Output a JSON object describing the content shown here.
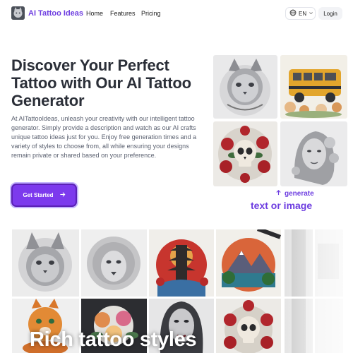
{
  "nav": {
    "brand": "AI Tattoo Ideas",
    "logo_icon": "cat-tattoo-logo-icon",
    "links": [
      "Home",
      "Features",
      "Pricing"
    ],
    "language": "EN",
    "globe_icon": "globe-icon",
    "chevron_icon": "chevron-down-icon",
    "login": "Login"
  },
  "hero": {
    "headline": "Discover Your Perfect Tattoo with Our AI Tattoo Generator",
    "description": "At AITattooIdeas, unleash your creativity with our intelligent tattoo generator. Simply provide a description and watch as our AI crafts unique tattoo ideas just for you. Enjoy free generation times and a variety of styles to choose from, all while ensuring your designs remain private or shared based on your preference.",
    "cta_label": "Get Started",
    "cta_icon": "arrow-right-icon",
    "images": [
      "cat-tattoo-image",
      "school-bus-tattoo-image",
      "skull-roses-tattoo-image",
      "woman-portrait-tattoo-image"
    ],
    "generate_note": "generate",
    "generate_note_icon": "arrow-up-icon",
    "generate_big": "text or image"
  },
  "gallery": {
    "images": [
      "lynx-tattoo-image",
      "lion-tattoo-image",
      "pagoda-tattoo-image",
      "landscape-circle-tattoo-image",
      "blurred-tattoo-image",
      "orange-cat-tattoo-image",
      "flower-bouquet-tattoo-image",
      "woman-portrait-tattoo-image",
      "skull-roses-tattoo-image",
      "blurred-tattoo-image"
    ],
    "title": "Rich tattoo styles"
  },
  "colors": {
    "accent": "#6d3de0",
    "button": "#7c3aed",
    "text": "#2b2f38"
  }
}
